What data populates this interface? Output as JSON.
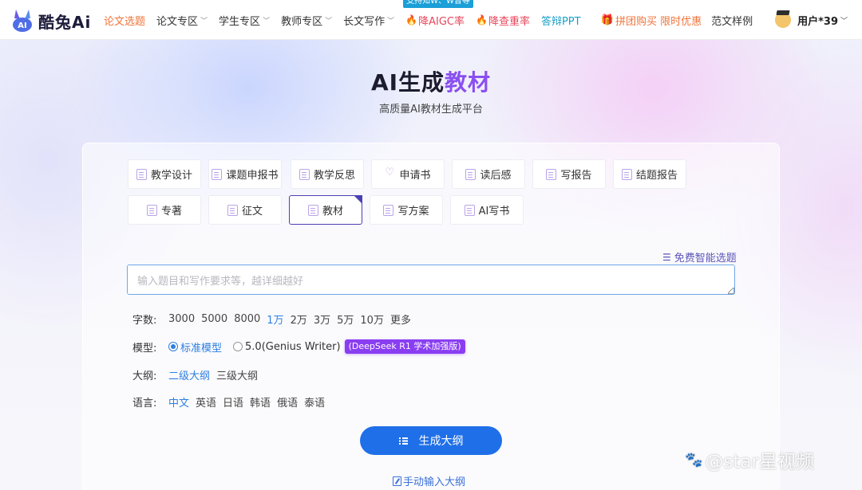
{
  "header": {
    "logo_text": "酷兔Ai",
    "nav": [
      {
        "label": "论文选题",
        "active": true,
        "dropdown": false
      },
      {
        "label": "论文专区",
        "dropdown": true
      },
      {
        "label": "学生专区",
        "dropdown": true
      },
      {
        "label": "教师专区",
        "dropdown": true
      },
      {
        "label": "长文写作",
        "dropdown": true
      }
    ],
    "badge": "支持知W、W普等",
    "special": [
      {
        "label": "降AIGC率",
        "color": "#e8455a"
      },
      {
        "label": "降查重率",
        "color": "#e8455a"
      },
      {
        "label": "答辩PPT",
        "color": "#1a9fc8"
      }
    ],
    "promo": "拼团购买 限时优惠",
    "samples": "范文样例",
    "user": "用户*39"
  },
  "hero": {
    "title_main": "AI生成",
    "title_accent": "教材",
    "subtitle": "高质量AI教材生成平台"
  },
  "categories": [
    {
      "label": "教学设计",
      "icon": "doc-icon"
    },
    {
      "label": "课题申报书",
      "icon": "doc-icon"
    },
    {
      "label": "教学反思",
      "icon": "doc-icon"
    },
    {
      "label": "申请书",
      "icon": "heart-icon"
    },
    {
      "label": "读后感",
      "icon": "calendar-icon"
    },
    {
      "label": "写报告",
      "icon": "search-doc-icon"
    },
    {
      "label": "结题报告",
      "icon": "doc-icon"
    },
    {
      "label": "专著",
      "icon": "book-icon"
    },
    {
      "label": "征文",
      "icon": "doc-icon"
    },
    {
      "label": "教材",
      "icon": "book-icon",
      "selected": true
    },
    {
      "label": "写方案",
      "icon": "edit-doc-icon"
    },
    {
      "label": "AI写书",
      "icon": "doc-icon"
    }
  ],
  "smart_topic": "免费智能选题",
  "input": {
    "placeholder": "输入题目和写作要求等，越详细越好",
    "value": ""
  },
  "options": {
    "word_count": {
      "label": "字数:",
      "items": [
        "3000",
        "5000",
        "8000",
        "1万",
        "2万",
        "3万",
        "5万",
        "10万",
        "更多"
      ],
      "selected": "1万"
    },
    "model": {
      "label": "模型:",
      "items": [
        "标准模型",
        "5.0(Genius Writer)"
      ],
      "selected": "标准模型",
      "badge": "(DeepSeek R1 学术加强版)"
    },
    "outline": {
      "label": "大纲:",
      "items": [
        "二级大纲",
        "三级大纲"
      ],
      "selected": "二级大纲"
    },
    "language": {
      "label": "语言:",
      "items": [
        "中文",
        "英语",
        "日语",
        "韩语",
        "俄语",
        "泰语"
      ],
      "selected": "中文"
    }
  },
  "generate_button": "生成大纲",
  "manual_outline": "手动输入大纲",
  "watermark": "@star星视频",
  "colors": {
    "accent": "#8a4ff0",
    "primary": "#1f6fe8",
    "active_nav": "#f0743a"
  }
}
